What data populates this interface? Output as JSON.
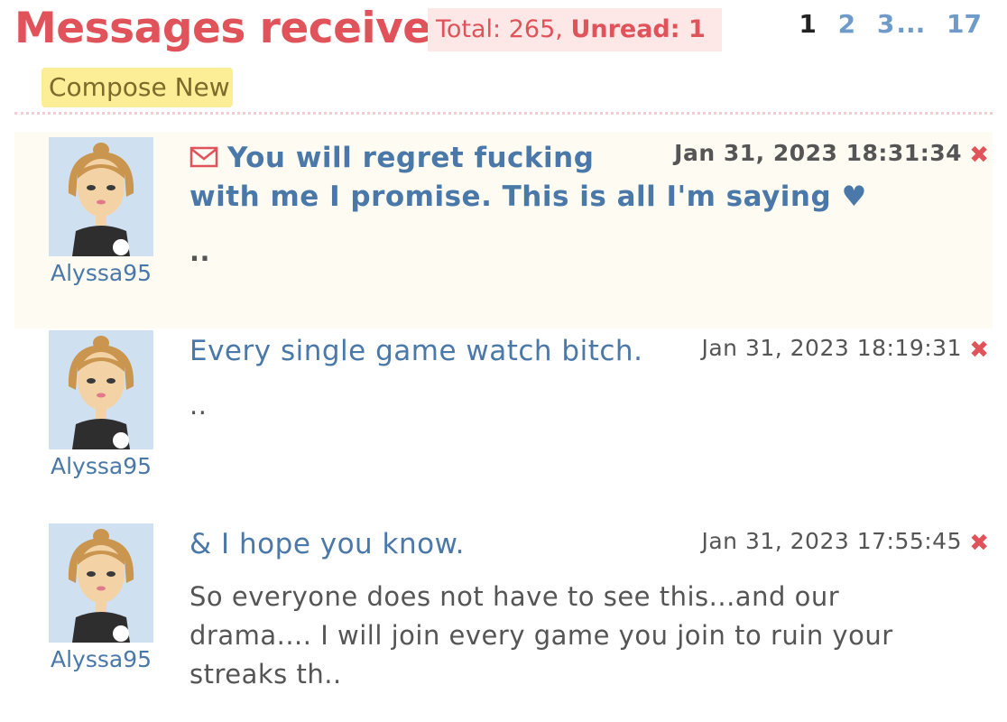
{
  "header": {
    "title": "Messages received",
    "total_label": "Total: 265, ",
    "unread_label": "Unread: 1",
    "pagination": {
      "current": "1",
      "pages": [
        "2",
        "3"
      ],
      "ellipsis": "...",
      "last": "17"
    }
  },
  "compose_label": "Compose New",
  "messages": [
    {
      "sender": "Alyssa95",
      "subject_line1": "You will regret fucking",
      "subject_line2": "with me I promise. This is all I'm saying ♥",
      "date": "Jan 31, 2023 18:31:34",
      "preview": "..",
      "unread": true,
      "icon": "envelope-icon"
    },
    {
      "sender": "Alyssa95",
      "subject_line1": "Every single game watch bitch.",
      "date": "Jan 31, 2023 18:19:31",
      "preview": "..",
      "unread": false
    },
    {
      "sender": "Alyssa95",
      "subject_line1": "& I hope you know.",
      "date": "Jan 31, 2023 17:55:45",
      "preview_line1": "So everyone does not have to see this...and our",
      "preview_line2": "drama.... I will join every game you join to ruin your",
      "preview_line3": "streaks th..",
      "unread": false
    }
  ],
  "delete_glyph": "✖",
  "colors": {
    "accent_red": "#e0535a",
    "link_blue": "#4a78a8",
    "compose_yellow": "#fbee96",
    "unread_bg": "#fdfbf2"
  }
}
